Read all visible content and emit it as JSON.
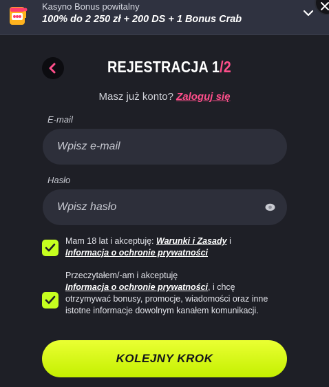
{
  "banner": {
    "subtitle": "Kasyno Bonus powitalny",
    "offer": "100% do 2 250 zł + 200 DS + 1 Bonus Crab"
  },
  "form": {
    "title_prefix": "REJESTRACJA 1",
    "title_total": "/2",
    "login_prompt": "Masz już konto?",
    "login_link": "Zaloguj się",
    "email": {
      "label": "E-mail",
      "placeholder": "Wpisz e-mail",
      "value": ""
    },
    "password": {
      "label": "Hasło",
      "placeholder": "Wpisz hasło",
      "value": ""
    },
    "consent1": {
      "checked": true,
      "text_before": "Mam 18 lat i akceptuję: ",
      "link1": "Warunki i Zasady",
      "text_middle": " i",
      "link2": "Informacja o ochronie prywatności"
    },
    "consent2": {
      "checked": true,
      "text_before": "Przeczytałem/-am i akceptuję",
      "link": "Informacja o ochronie prywatności",
      "text_after": ", i chcę otrzymywać bonusy, promocje, wiadomości oraz inne istotne informacje dowolnym kanałem komunikacji."
    },
    "next_button": "KOLEJNY KROK"
  },
  "colors": {
    "accent_pink": "#ff4f8b",
    "accent_lime": "#c6ff1f",
    "background": "#1e1f26",
    "input_bg": "#2d2f3a"
  },
  "icons": [
    "slot-machine-icon",
    "chevron-down-icon",
    "close-icon",
    "back-arrow-icon",
    "eye-icon",
    "checkmark-icon"
  ]
}
